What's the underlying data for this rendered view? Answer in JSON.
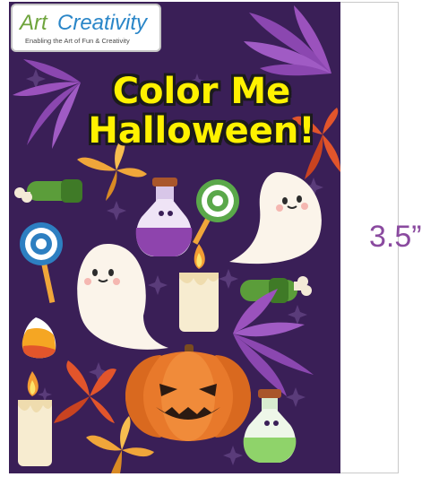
{
  "logo": {
    "art": "Art",
    "creativity": "Creativity",
    "tagline": "Enabling the Art of Fun & Creativity"
  },
  "cover": {
    "title_line1": "Color Me",
    "title_line2": "Halloween!"
  },
  "dimension_label": "3.5”",
  "colors": {
    "background": "#3a1f57",
    "title": "#fff200",
    "dimension": "#8a4a9f",
    "pumpkin": "#e8792b",
    "ghost": "#fbf4ea",
    "leaf_purple": "#8b47b0"
  },
  "icons": [
    "logo",
    "ghost-icon",
    "pumpkin-icon",
    "candle-icon",
    "potion-icon",
    "lollipop-icon",
    "zombie-arm-icon",
    "candy-corn-icon",
    "leaf-icon",
    "star-icon"
  ]
}
